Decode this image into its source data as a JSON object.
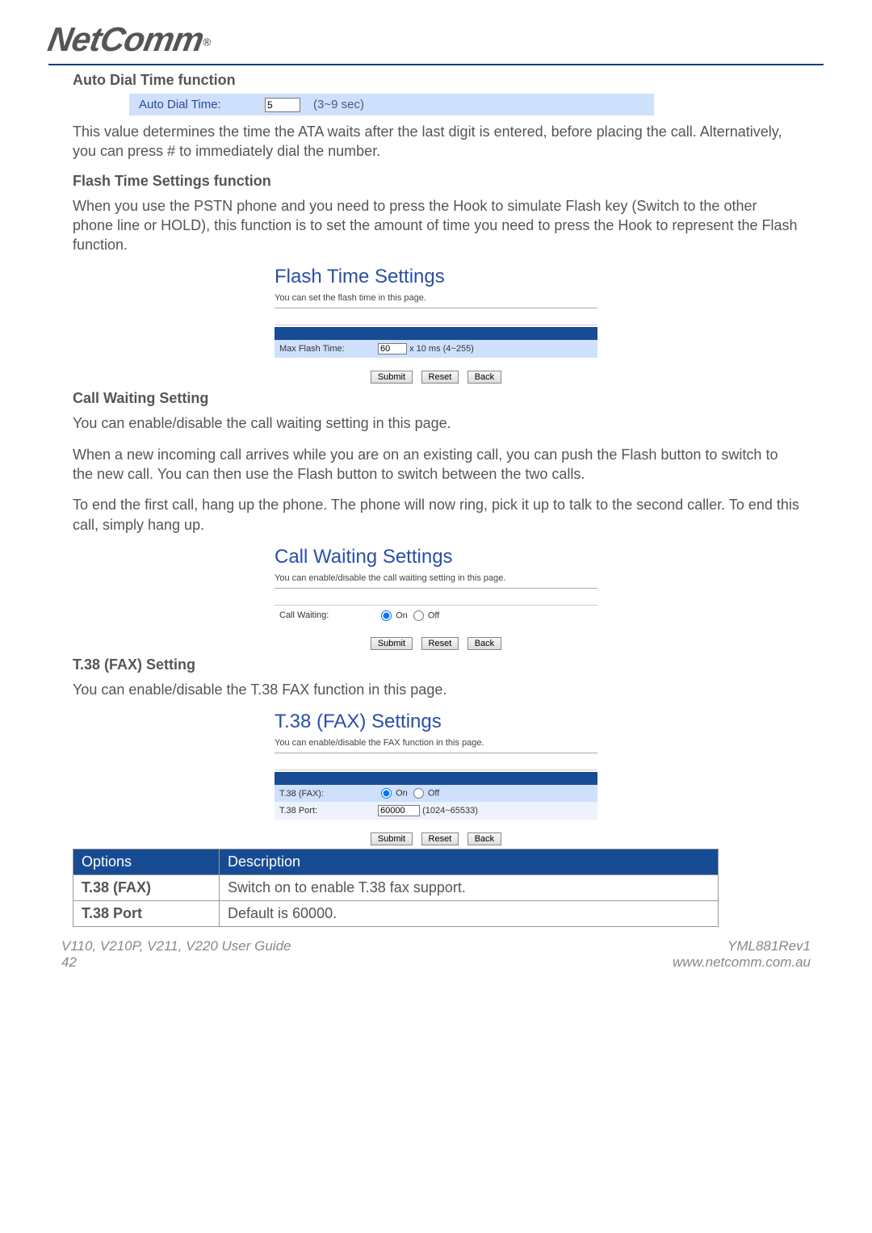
{
  "brand": "NetComm",
  "brand_reg": "®",
  "sections": {
    "autodial": {
      "title": "Auto Dial Time function",
      "label": "Auto Dial Time:",
      "value": "5",
      "range": "(3~9 sec)",
      "desc": "This value determines the time the ATA waits after the last digit is entered, before placing the call. Alternatively, you can press # to immediately dial the number."
    },
    "flash": {
      "title": "Flash Time Settings function",
      "desc": "When you use the PSTN phone and you need to press the Hook to simulate Flash key (Switch to the other phone line or HOLD), this function is to set the amount of time you need to press the Hook to represent the Flash function.",
      "panel": {
        "heading": "Flash Time Settings",
        "sub": "You can set the flash time in this page.",
        "field_label": "Max Flash Time:",
        "value": "60",
        "unit": "x 10 ms (4~255)"
      }
    },
    "callwaiting": {
      "title": "Call Waiting Setting",
      "p1": "You can enable/disable the call waiting setting in this page.",
      "p2": "When a new incoming call arrives while you are on an existing call, you can push the Flash button to switch to the new call. You can then use the Flash button to switch between the two calls.",
      "p3": "To end the first call, hang up the phone. The phone will now ring, pick it up to talk to the second caller. To end this call, simply hang up.",
      "panel": {
        "heading": "Call Waiting Settings",
        "sub": "You can enable/disable the call waiting setting in this page.",
        "field_label": "Call Waiting:",
        "on": "On",
        "off": "Off"
      }
    },
    "t38": {
      "title": "T.38 (FAX) Setting",
      "p1": "You can enable/disable the T.38 FAX function in this page.",
      "panel": {
        "heading": "T.38 (FAX) Settings",
        "sub": "You can enable/disable the FAX function in this page.",
        "row1_label": "T.38 (FAX):",
        "on": "On",
        "off": "Off",
        "row2_label": "T.38 Port:",
        "port_value": "60000",
        "port_range": "(1024~65533)"
      }
    }
  },
  "buttons": {
    "submit": "Submit",
    "reset": "Reset",
    "back": "Back"
  },
  "options_table": {
    "h1": "Options",
    "h2": "Description",
    "rows": [
      {
        "opt": "T.38 (FAX)",
        "desc": "Switch on to enable T.38 fax support."
      },
      {
        "opt": "T.38 Port",
        "desc": "Default is 60000."
      }
    ]
  },
  "footer": {
    "left1": "V110, V210P, V211, V220 User Guide",
    "left2": "42",
    "right1": "YML881Rev1",
    "right2": "www.netcomm.com.au"
  }
}
